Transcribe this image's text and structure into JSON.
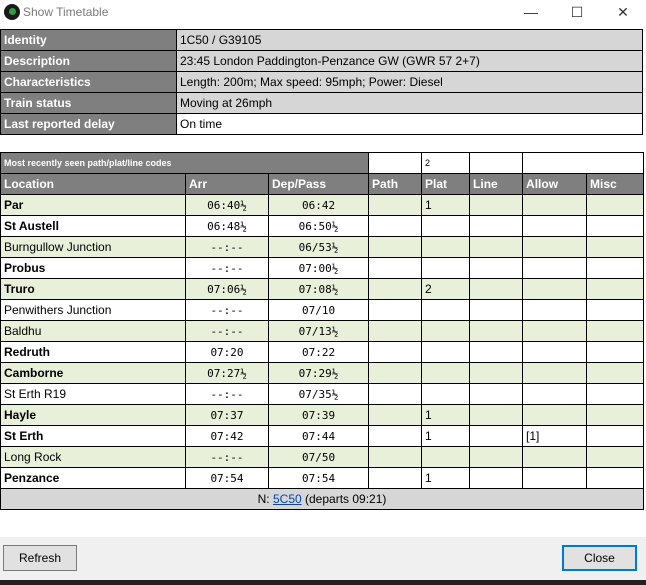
{
  "window": {
    "title": "Show Timetable",
    "min": "—",
    "max": "☐",
    "close": "✕"
  },
  "info": [
    {
      "label": "Identity",
      "value": "1C50 / G39105"
    },
    {
      "label": "Description",
      "value": "23:45 London Paddington-Penzance GW (GWR 57 2+7)"
    },
    {
      "label": "Characteristics",
      "value": "Length: 200m; Max speed: 95mph; Power: Diesel"
    },
    {
      "label": "Train status",
      "value": "Moving at 26mph"
    },
    {
      "label": "Last reported delay",
      "value": "On time"
    }
  ],
  "codes": {
    "label": "Most recently seen path/plat/line codes",
    "path": "",
    "plat": "2",
    "line": "",
    "allow": ""
  },
  "columns": [
    "Location",
    "Arr",
    "Dep/Pass",
    "Path",
    "Plat",
    "Line",
    "Allow",
    "Misc"
  ],
  "rows": [
    {
      "loc": "Par",
      "bold": true,
      "arr": "06:40½",
      "dep": "06:42",
      "path": "",
      "plat": "1",
      "line": "",
      "allow": "",
      "misc": ""
    },
    {
      "loc": "St Austell",
      "bold": true,
      "arr": "06:48½",
      "dep": "06:50½",
      "path": "",
      "plat": "",
      "line": "",
      "allow": "",
      "misc": ""
    },
    {
      "loc": "Burngullow Junction",
      "bold": false,
      "arr": "--:--",
      "dep": "06/53½",
      "path": "",
      "plat": "",
      "line": "",
      "allow": "",
      "misc": ""
    },
    {
      "loc": "Probus",
      "bold": true,
      "arr": "--:--",
      "dep": "07:00½",
      "path": "",
      "plat": "",
      "line": "",
      "allow": "",
      "misc": ""
    },
    {
      "loc": "Truro",
      "bold": true,
      "arr": "07:06½",
      "dep": "07:08½",
      "path": "",
      "plat": "2",
      "line": "",
      "allow": "",
      "misc": ""
    },
    {
      "loc": "Penwithers Junction",
      "bold": false,
      "arr": "--:--",
      "dep": "07/10",
      "path": "",
      "plat": "",
      "line": "",
      "allow": "",
      "misc": ""
    },
    {
      "loc": "Baldhu",
      "bold": false,
      "arr": "--:--",
      "dep": "07/13½",
      "path": "",
      "plat": "",
      "line": "",
      "allow": "",
      "misc": ""
    },
    {
      "loc": "Redruth",
      "bold": true,
      "arr": "07:20",
      "dep": "07:22",
      "path": "",
      "plat": "",
      "line": "",
      "allow": "",
      "misc": ""
    },
    {
      "loc": "Camborne",
      "bold": true,
      "arr": "07:27½",
      "dep": "07:29½",
      "path": "",
      "plat": "",
      "line": "",
      "allow": "",
      "misc": ""
    },
    {
      "loc": "St Erth R19",
      "bold": false,
      "arr": "--:--",
      "dep": "07/35½",
      "path": "",
      "plat": "",
      "line": "",
      "allow": "",
      "misc": ""
    },
    {
      "loc": "Hayle",
      "bold": true,
      "arr": "07:37",
      "dep": "07:39",
      "path": "",
      "plat": "1",
      "line": "",
      "allow": "",
      "misc": ""
    },
    {
      "loc": "St Erth",
      "bold": true,
      "arr": "07:42",
      "dep": "07:44",
      "path": "",
      "plat": "1",
      "line": "",
      "allow": "[1]",
      "misc": ""
    },
    {
      "loc": "Long Rock",
      "bold": false,
      "arr": "--:--",
      "dep": "07/50",
      "path": "",
      "plat": "",
      "line": "",
      "allow": "",
      "misc": ""
    },
    {
      "loc": "Penzance",
      "bold": true,
      "arr": "07:54",
      "dep": "07:54",
      "path": "",
      "plat": "1",
      "line": "",
      "allow": "",
      "misc": ""
    }
  ],
  "footer": {
    "prefix": "N: ",
    "link": "5C50",
    "suffix": " (departs 09:21)"
  },
  "buttons": {
    "refresh": "Refresh",
    "close": "Close"
  }
}
